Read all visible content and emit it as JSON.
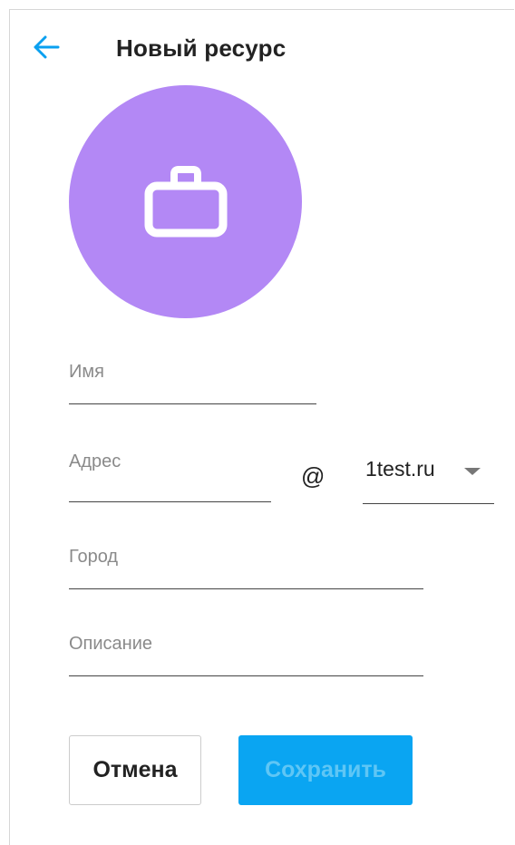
{
  "header": {
    "title": "Новый ресурс",
    "back_icon": "arrow-left-icon"
  },
  "avatar": {
    "icon": "briefcase-icon",
    "color": "#b388f5"
  },
  "form": {
    "name_label": "Имя",
    "address_label": "Адрес",
    "at_sign": "@",
    "domain_value": "1test.ru",
    "city_label": "Город",
    "description_label": "Описание"
  },
  "actions": {
    "cancel_label": "Отмена",
    "save_label": "Сохранить"
  },
  "colors": {
    "accent": "#0aa0f0",
    "save_bg": "#0aa5f2",
    "save_text": "#5fc6f5",
    "avatar": "#b388f5"
  }
}
